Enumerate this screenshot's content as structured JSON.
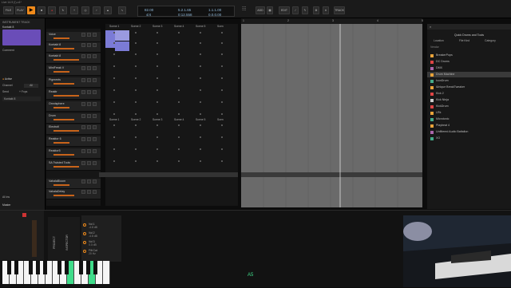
{
  "title": "Live 14.9 (!)-o1*",
  "toolbar": {
    "file": "FILE",
    "play": "PLAY",
    "add": "ADD",
    "edit": "EDIT",
    "track": "TRACK",
    "tempo": "82.00",
    "sig": "4/4",
    "pos1": "5.2.1.65",
    "pos2": "0:12.558",
    "pos3": "1.1.1.00",
    "pos4": "0.0.0.00"
  },
  "left": {
    "header": "INSTRUMENT TRACK",
    "dev": "Kontakt 8",
    "comment": "Comment",
    "active": "Active",
    "channel": "Channel",
    "all": "All",
    "send": "Send",
    "fx": "+ Fxps",
    "aux": "Kontakt 8",
    "allins": "All ins",
    "master": "Master"
  },
  "tracks": [
    "Voice",
    "Kontakt 8",
    "Kontakt 8",
    "MiniFreak V",
    "Pigments",
    "Reaktr",
    "Omnisphere",
    "Drum",
    "Electrofi",
    "Reaktor 6",
    "Reaktor5",
    "SA Twisted Tools",
    "VahalaBloom",
    "VahalaDelay"
  ],
  "scenes": [
    "Scene 1",
    "Scene 2",
    "Scene 3",
    "Scene 4",
    "Scene 5",
    "Scen"
  ],
  "ruler": [
    "1",
    "2",
    "3",
    "4",
    "5"
  ],
  "browser": {
    "title": "Quick Drums and Tools",
    "tabs": [
      "Location",
      "File Kind",
      "Category"
    ],
    "sub": "Vendor",
    "items": [
      "BreakerPops",
      "DC Drums",
      "DMX",
      "Drum Machine",
      "IconDrum",
      "iUnique BreakTweaker",
      "Kick 2",
      "Kick Ninja",
      "KickDrum",
      "LRk",
      "Microtonic",
      "Playbeat 4",
      "Unfiltered Audio Battalion",
      "XO"
    ],
    "colors": [
      "#e8a33a",
      "#d44",
      "#a6a",
      "#e8a33a",
      "#4a8",
      "#e8a33a",
      "#d44",
      "#ccc",
      "#d44",
      "#e8a33a",
      "#4a8",
      "#e8a33a",
      "#a6a",
      "#4a8"
    ]
  },
  "bottom": {
    "labels": [
      "Vol 1",
      "Vol 2",
      "Vol 3",
      "Filt Cut"
    ],
    "vals": [
      "-4.8 dB",
      "-4.8 dB",
      "0.0 dB",
      "20 Hz"
    ],
    "note": "A5",
    "tabs": [
      "PROJECT",
      "INSPECTOR",
      "MIXER"
    ]
  }
}
